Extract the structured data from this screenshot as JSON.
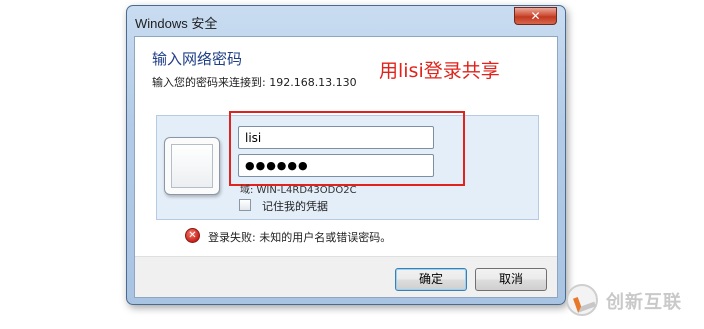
{
  "window": {
    "title": "Windows 安全",
    "close_label": "✕"
  },
  "header": {
    "heading": "输入网络密码",
    "subline": "输入您的密码来连接到: 192.168.13.130"
  },
  "annotation": "用lisi登录共享",
  "credentials": {
    "username_value": "lisi",
    "password_value": "●●●●●●",
    "domain_line": "域: WIN-L4RD43ODO2C",
    "remember_label": "记住我的凭据",
    "remember_checked": false
  },
  "error": {
    "icon": "x-circle-icon",
    "text": "登录失败: 未知的用户名或错误密码。"
  },
  "buttons": {
    "ok_label": "确定",
    "cancel_label": "取消"
  },
  "watermark": {
    "text": "创新互联"
  },
  "colors": {
    "annotation": "#e0231c",
    "heading": "#1f3f86",
    "frame": "#b3cbe6",
    "error": "#c8221b"
  }
}
